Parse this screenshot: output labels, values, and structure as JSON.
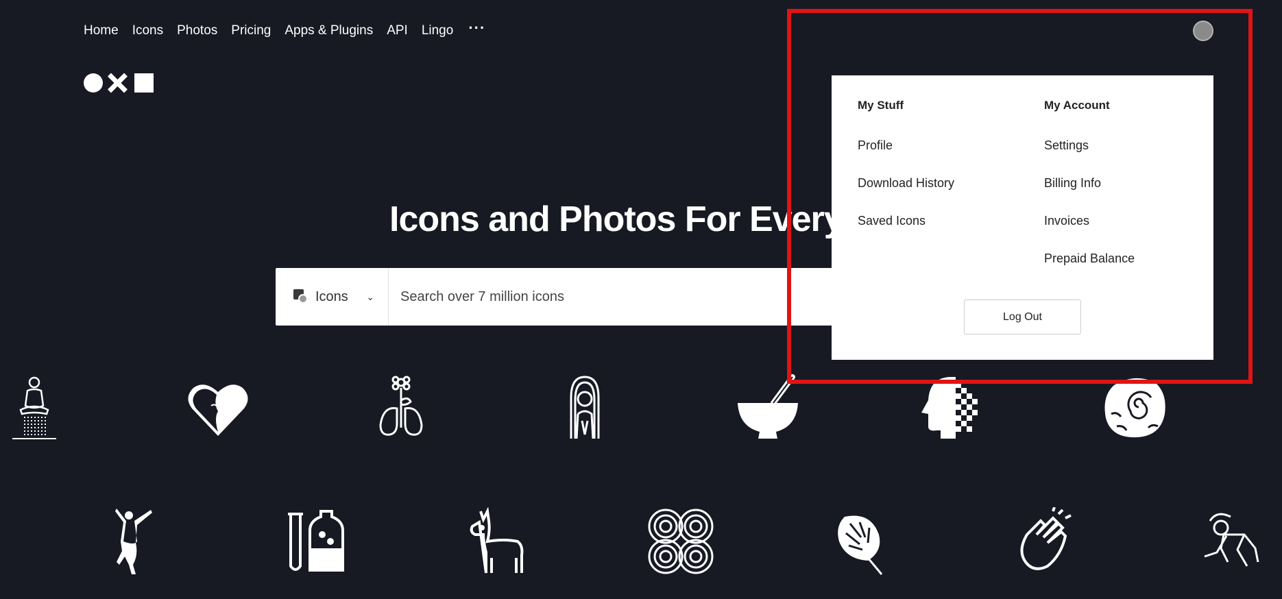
{
  "nav": {
    "items": [
      "Home",
      "Icons",
      "Photos",
      "Pricing",
      "Apps & Plugins",
      "API",
      "Lingo"
    ],
    "more": "···"
  },
  "hero": {
    "title": "Icons and Photos For Everyt"
  },
  "search": {
    "type_label": "Icons",
    "placeholder": "Search over 7 million icons"
  },
  "menu": {
    "my_stuff": {
      "heading": "My Stuff",
      "items": [
        "Profile",
        "Download History",
        "Saved Icons"
      ]
    },
    "my_account": {
      "heading": "My Account",
      "items": [
        "Settings",
        "Billing Info",
        "Invoices",
        "Prepaid Balance"
      ]
    },
    "logout": "Log Out"
  },
  "icons": {
    "row1": [
      "meditation-icon",
      "heart-face-icon",
      "lungs-flower-icon",
      "woman-portrait-icon",
      "mortar-pestle-icon",
      "pixel-head-icon",
      "fossil-icon"
    ],
    "row2": [
      "dancer-icon",
      "test-tube-bottle-icon",
      "llama-icon",
      "infinity-loops-icon",
      "monstera-leaf-icon",
      "clapping-hands-icon",
      "crawling-figure-icon"
    ]
  },
  "colors": {
    "background": "#171923",
    "highlight": "#e01414"
  }
}
